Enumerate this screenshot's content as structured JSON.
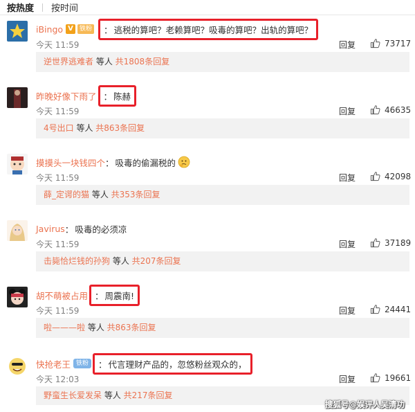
{
  "tabs": [
    {
      "label": "按热度"
    },
    {
      "label": "按时间"
    }
  ],
  "reply_label": "回复",
  "comments": [
    {
      "user": "iBingo",
      "badges": {
        "v": "V",
        "fan": "铁粉"
      },
      "text": "逃税的算吧？老赖算吧？吸毒的算吧？出轨的算吧？",
      "time": "今天 11:59",
      "likes": "73717",
      "sub": {
        "who": "逆世界逃难者",
        "mid": " 等人 ",
        "count": "共1808条回复"
      }
    },
    {
      "user": "昨晚好像下雨了",
      "text": "陈赫",
      "time": "今天 11:59",
      "likes": "46635",
      "sub": {
        "who": "4号出口",
        "mid": " 等人 ",
        "count": "共863条回复"
      }
    },
    {
      "user": "摸摸头一块钱四个",
      "text": "吸毒的偷漏税的",
      "emoji": "thinking-emoji",
      "time": "今天 11:59",
      "likes": "42098",
      "sub": {
        "who": "薛_定谔的猫",
        "mid": " 等人 ",
        "count": "共353条回复"
      }
    },
    {
      "user": "Javirus",
      "text": "吸毒的必须凉",
      "time": "今天 11:59",
      "likes": "37189",
      "sub": {
        "who": "击毙恰烂钱的孙狗",
        "mid": " 等人 ",
        "count": "共207条回复"
      }
    },
    {
      "user": "胡不萌被占用",
      "text": "周震南!",
      "time": "今天 11:59",
      "likes": "24441",
      "sub": {
        "who": "啦———啦",
        "mid": " 等人 ",
        "count": "共863条回复"
      }
    },
    {
      "user": "快抢老王",
      "badges": {
        "blue": "铁粉"
      },
      "text": "代言理财产品的，忽悠粉丝观众的，",
      "time": "今天 12:03",
      "likes": "19661",
      "sub": {
        "who": "野蛮生长爱发呆",
        "mid": " 等人 ",
        "count": "共217条回复"
      }
    }
  ],
  "watermark": "搜狐号@娱评人吴清功",
  "colors": {
    "username": "#eb7350",
    "highlight": "#e8202a",
    "subbg": "#f2f2f2"
  }
}
